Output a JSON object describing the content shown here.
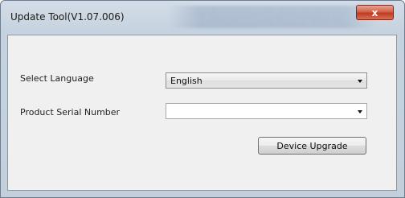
{
  "window": {
    "title": "Update Tool(V1.07.006)",
    "close_label": "x"
  },
  "form": {
    "language_label": "Select Language",
    "language_value": "English",
    "serial_label": "Product Serial Number",
    "serial_value": "",
    "upgrade_button": "Device Upgrade"
  },
  "icons": {
    "close": "close-icon",
    "dropdown": "chevron-down-icon"
  },
  "colors": {
    "close_button": "#c13b20",
    "frame": "#c5d2df",
    "client_bg": "#f0f0f0"
  }
}
